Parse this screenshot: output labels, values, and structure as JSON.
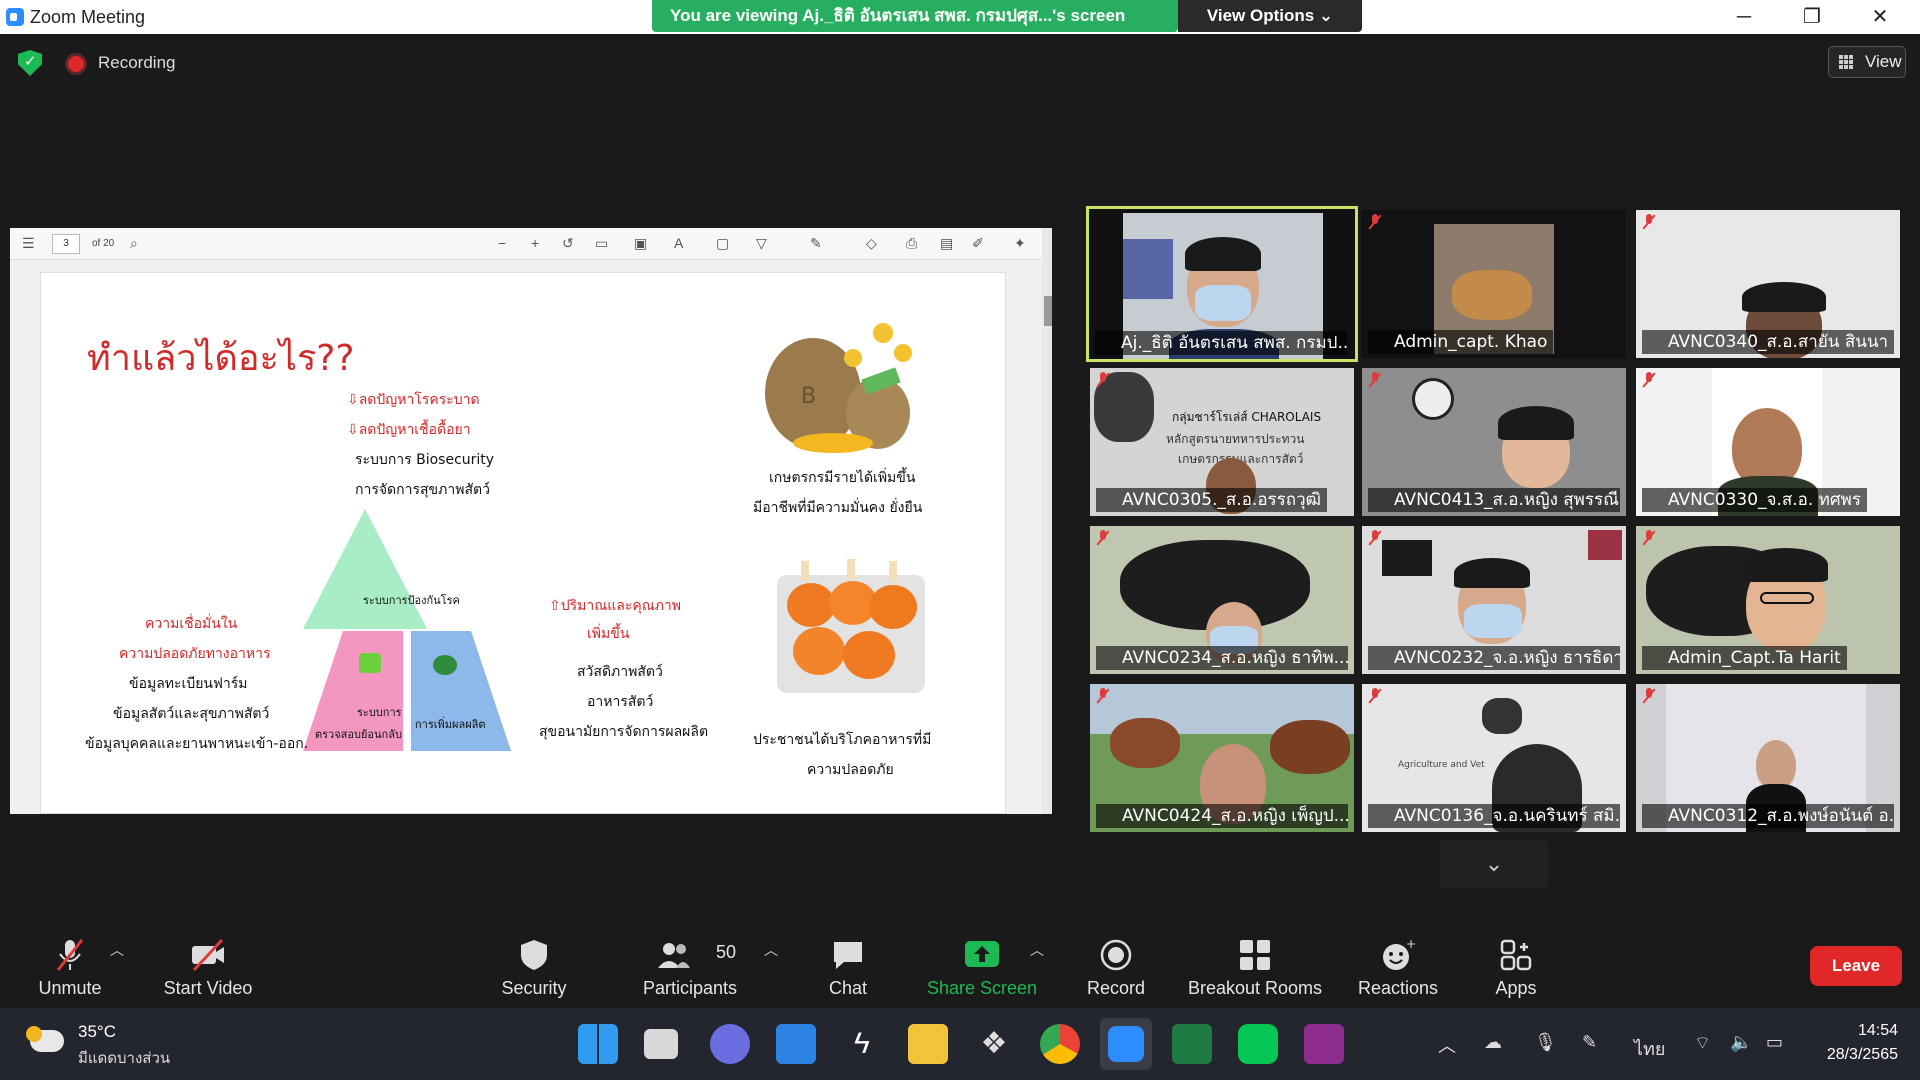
{
  "window": {
    "title": "Zoom Meeting",
    "minimize": "─",
    "maximize": "❐",
    "close": "✕"
  },
  "banner": {
    "viewing_text": "You are viewing Aj._ธิติ อันตรเสน สพส. กรมปศุส...'s screen",
    "view_options": "View Options ⌄"
  },
  "meeting": {
    "recording_label": "Recording",
    "view_label": "View"
  },
  "pdf_viewer": {
    "page": "3",
    "page_of": "of 20"
  },
  "slide": {
    "title": "ทำแล้วได้อะไร??",
    "top_center": [
      "⇩ลดปัญหาโรคระบาด",
      "⇩ลดปัญหาเชื้อดื้อยา",
      "ระบบการ Biosecurity",
      "การจัดการสุขภาพสัตว์"
    ],
    "pyramid_top": "ระบบการป้องกันโรค",
    "pyramid_left": [
      "ระบบการ",
      "ตรวจสอบย้อนกลับ"
    ],
    "pyramid_right": "การเพิ่มผลผลิต",
    "left_block": [
      "ความเชื่อมั่นใน",
      "ความปลอดภัยทางอาหาร",
      "ข้อมูลทะเบียนฟาร์ม",
      "ข้อมูลสัตว์และสุขภาพสัตว์",
      "ข้อมูลบุคคลและยานพาหนะเข้า-ออก."
    ],
    "mid_block": [
      "⇧ปริมาณและคุณภาพ",
      "เพิ่มขึ้น",
      "สวัสดิภาพสัตว์",
      "อาหารสัตว์",
      "สุขอนามัยการจัดการผลผลิต"
    ],
    "right_top": [
      "เกษตรกรมีรายได้เพิ่มขึ้น",
      "มีอาชีพที่มีความมั่นคง ยั่งยืน"
    ],
    "right_bottom": [
      "ประชาชนได้บริโภคอาหารที่มี",
      "ความปลอดภัย"
    ]
  },
  "participants_gallery": [
    {
      "name": "Aj._ธิติ อันตรเสน สพส. กรมป...",
      "active_speaker": true
    },
    {
      "name": "Admin_capt. Khao"
    },
    {
      "name": "AVNC0340_ส.อ.สายัน สินนา"
    },
    {
      "name": "AVNC0305._ส.อ.อรรถวุฒิ"
    },
    {
      "name": "AVNC0413_ส.อ.หญิง สุพรรณี"
    },
    {
      "name": "AVNC0330_จ.ส.อ. ทศพร"
    },
    {
      "name": "AVNC0234_ส.อ.หญิง ธาทิพ..."
    },
    {
      "name": "AVNC0232_จ.อ.หญิง ธารธิดา"
    },
    {
      "name": "Admin_Capt.Ta Harit"
    },
    {
      "name": "AVNC0424_ส.อ.หญิง เพ็ญป..."
    },
    {
      "name": "AVNC0136_จ.อ.นครินทร์ สมิ..."
    },
    {
      "name": "AVNC0312_ส.อ.พงษ์อนันต์ อ..."
    }
  ],
  "tile_text": {
    "charolais_line1": "กลุ่มชาร์โรเล่ส์ CHAROLAIS",
    "charolais_line2": "หลักสูตรนายทหารประทวน",
    "charolais_line3": "เกษตรกรรมและการสัตว์",
    "agri": "Agriculture and Vet"
  },
  "controls": {
    "unmute": "Unmute",
    "start_video": "Start Video",
    "security": "Security",
    "participants": "Participants",
    "participants_count": "50",
    "chat": "Chat",
    "share_screen": "Share Screen",
    "record": "Record",
    "breakout_rooms": "Breakout Rooms",
    "reactions": "Reactions",
    "apps": "Apps",
    "leave": "Leave",
    "share_color": "#1db954",
    "leave_color": "#e02828"
  },
  "taskbar": {
    "temperature": "35°C",
    "weather": "มีแดดบางส่วน",
    "lang": "ไทย",
    "time": "14:54",
    "date": "28/3/2565"
  }
}
